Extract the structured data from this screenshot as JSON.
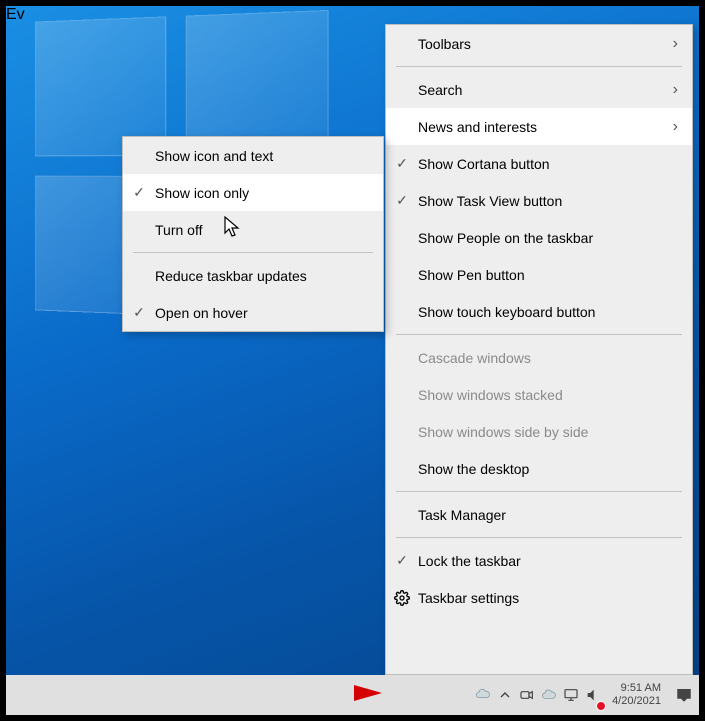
{
  "main_menu": {
    "toolbars": "Toolbars",
    "search": "Search",
    "news": "News and interests",
    "cortana": "Show Cortana button",
    "taskview": "Show Task View button",
    "people": "Show People on the taskbar",
    "pen": "Show Pen button",
    "touch": "Show touch keyboard button",
    "cascade": "Cascade windows",
    "stacked": "Show windows stacked",
    "sidebyside": "Show windows side by side",
    "desktop": "Show the desktop",
    "taskmgr": "Task Manager",
    "lock": "Lock the taskbar",
    "settings": "Taskbar settings"
  },
  "sub_menu": {
    "icon_text": "Show icon and text",
    "icon_only": "Show icon only",
    "turn_off": "Turn off",
    "reduce": "Reduce taskbar updates",
    "hover": "Open on hover"
  },
  "tray": {
    "time": "9:51 AM",
    "date": "4/20/2021",
    "eve_fragment": "Ev"
  }
}
